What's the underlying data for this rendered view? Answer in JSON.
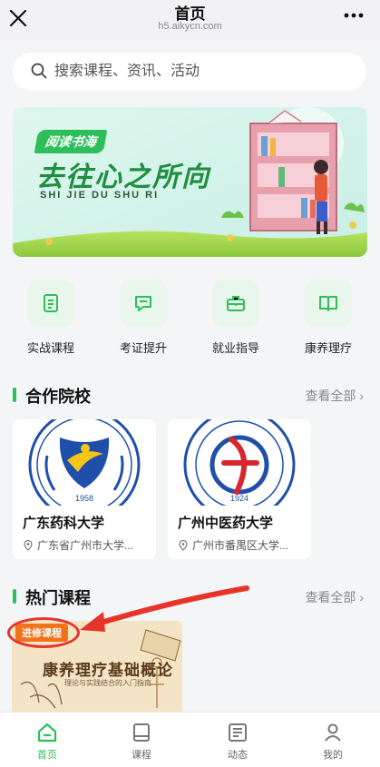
{
  "topbar": {
    "title": "首页",
    "subtitle": "h5.aikycn.com"
  },
  "search": {
    "placeholder": "搜索课程、资讯、活动"
  },
  "banner": {
    "tag": "阅读书海",
    "title": "去往心之所向",
    "subtitle": "SHI JIE DU SHU RI"
  },
  "quick_nav": [
    {
      "label": "实战课程",
      "icon": "document-icon"
    },
    {
      "label": "考证提升",
      "icon": "chat-icon"
    },
    {
      "label": "就业指导",
      "icon": "briefcase-icon"
    },
    {
      "label": "康养理疗",
      "icon": "book-icon"
    }
  ],
  "partners": {
    "title": "合作院校",
    "more": "查看全部 ›",
    "items": [
      {
        "name": "广东药科大学",
        "location": "广东省广州市大学...",
        "logo_year": "1958"
      },
      {
        "name": "广州中医药大学",
        "location": "广州市番禺区大学...",
        "logo_year": "1924"
      }
    ]
  },
  "hot_courses": {
    "title": "热门课程",
    "more": "查看全部 ›",
    "items": [
      {
        "badge": "进修课程",
        "title": "康养理疗基础概论",
        "subtitle": "理论与实践结合的入门指南"
      }
    ]
  },
  "tabbar": [
    {
      "label": "首页",
      "icon": "home-icon",
      "active": true
    },
    {
      "label": "课程",
      "icon": "course-icon",
      "active": false
    },
    {
      "label": "动态",
      "icon": "news-icon",
      "active": false
    },
    {
      "label": "我的",
      "icon": "profile-icon",
      "active": false
    }
  ],
  "colors": {
    "accent": "#2fbf5a",
    "badge": "#f0731c",
    "annotation": "#e8332b"
  }
}
